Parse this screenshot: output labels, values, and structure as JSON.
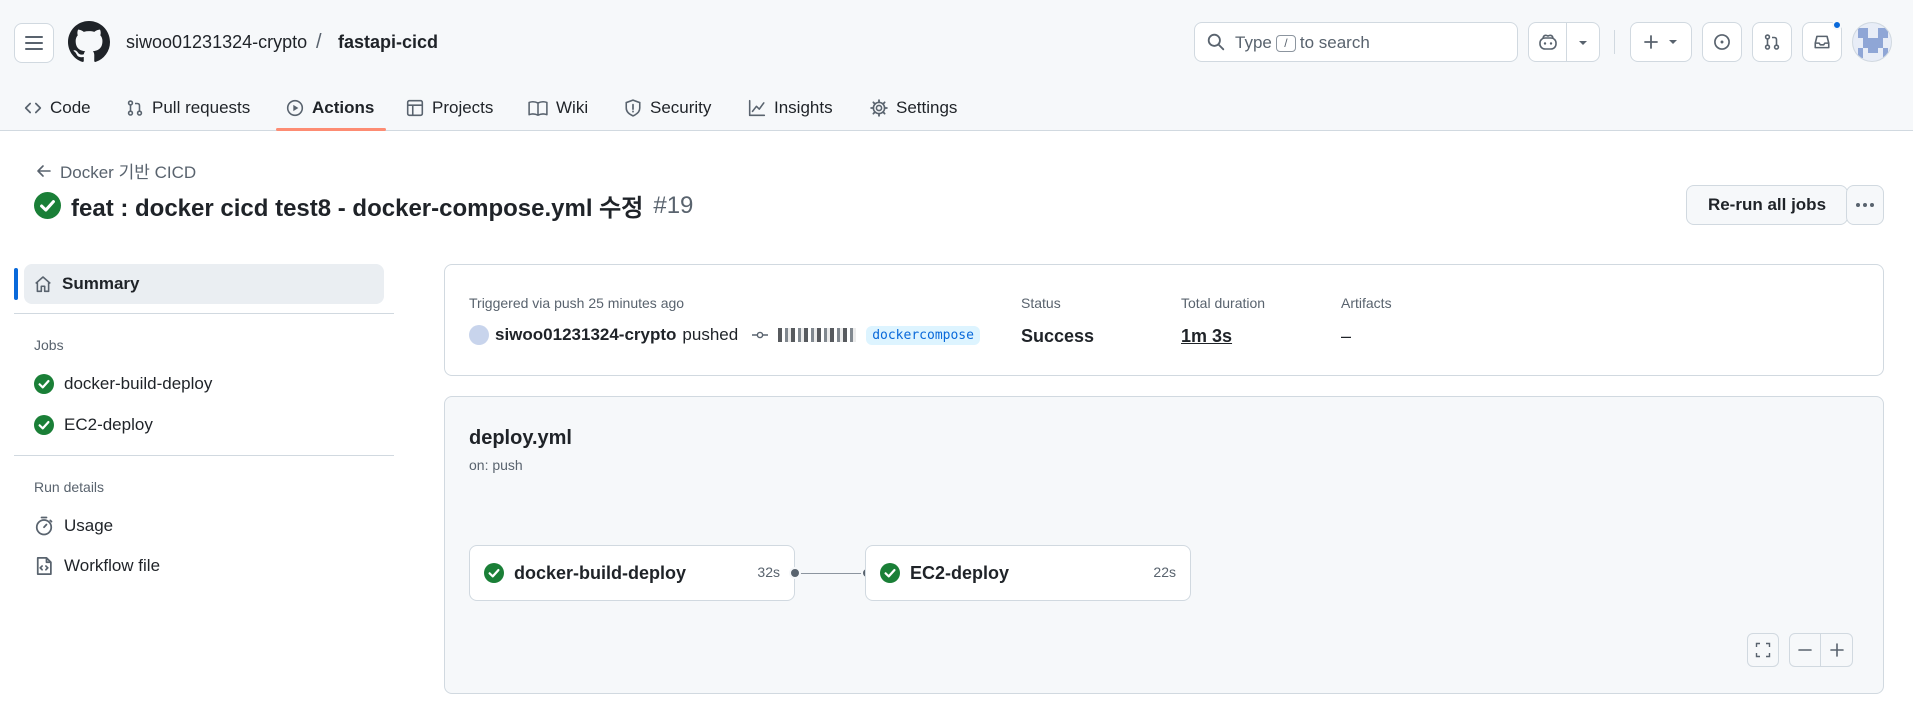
{
  "header": {
    "owner": "siwoo01231324-crypto",
    "separator": "/",
    "repo": "fastapi-cicd",
    "search": {
      "prefix": "Type",
      "key": "/",
      "suffix": "to search"
    }
  },
  "tabs": [
    {
      "label": "Code"
    },
    {
      "label": "Pull requests"
    },
    {
      "label": "Actions"
    },
    {
      "label": "Projects"
    },
    {
      "label": "Wiki"
    },
    {
      "label": "Security"
    },
    {
      "label": "Insights"
    },
    {
      "label": "Settings"
    }
  ],
  "run": {
    "back_label": "Docker 기반 CICD",
    "title": "feat : docker cicd test8 - docker-compose.yml 수정",
    "number": "#19",
    "rerun_label": "Re-run all jobs"
  },
  "sidebar": {
    "summary_label": "Summary",
    "jobs_heading": "Jobs",
    "jobs": [
      {
        "label": "docker-build-deploy"
      },
      {
        "label": "EC2-deploy"
      }
    ],
    "run_details_heading": "Run details",
    "details": [
      {
        "label": "Usage"
      },
      {
        "label": "Workflow file"
      }
    ]
  },
  "summary": {
    "trigger_label": "Triggered via push 25 minutes ago",
    "user": "siwoo01231324-crypto",
    "action": "pushed",
    "branch": "dockercompose",
    "status_label": "Status",
    "status_value": "Success",
    "duration_label": "Total duration",
    "duration_value": "1m 3s",
    "artifacts_label": "Artifacts",
    "artifacts_value": "–"
  },
  "workflow": {
    "file": "deploy.yml",
    "trigger": "on: push",
    "jobs": [
      {
        "name": "docker-build-deploy",
        "duration": "32s"
      },
      {
        "name": "EC2-deploy",
        "duration": "22s"
      }
    ]
  },
  "colors": {
    "success": "#1a7f37",
    "accent": "#0969da",
    "tab_underline": "#fd8c73"
  }
}
